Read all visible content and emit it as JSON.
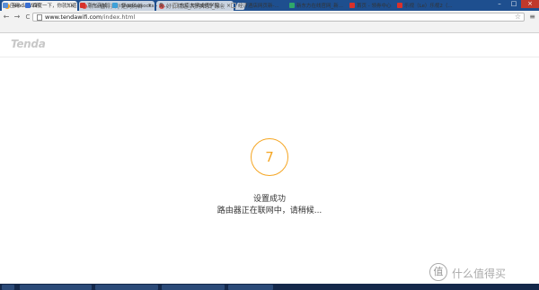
{
  "browser": {
    "tabs": [
      {
        "title": "Tenda WiFi",
        "active": true,
        "favicon_color": "#f5a623"
      },
      {
        "title": "什么值得买 | 是网购首",
        "active": false,
        "favicon_color": "#d9534f"
      },
      {
        "title": "好价精选_网购晒货_原创",
        "active": false,
        "favicon_color": "#d9534f"
      }
    ],
    "close_glyph": "×",
    "window_controls": [
      "–",
      "□",
      "×"
    ],
    "nav": {
      "back": "←",
      "forward": "→",
      "reload": "C"
    },
    "address": {
      "host": "www.tendawifi.com",
      "path": "/index.html"
    },
    "bookmarks": [
      {
        "label": "应用",
        "icon_color": "#5b8fd6"
      },
      {
        "label": "百度一下，你就知道",
        "icon_color": "#3b6fd1"
      },
      {
        "label": "京东商城",
        "icon_color": "#d9312b"
      },
      {
        "label": "iShadowsocks - 免...",
        "icon_color": "#3fa0d8"
      },
      {
        "label": "东南大学成贤学院...",
        "icon_color": "#999999"
      },
      {
        "label": "经济酒店网页新-...",
        "icon_color": "#999999"
      },
      {
        "label": "新东方在线官网_新...",
        "icon_color": "#2fa86a"
      },
      {
        "label": "首页 - 领券中心",
        "icon_color": "#d9312b"
      },
      {
        "label": "乐视（Le）乐视2（...",
        "icon_color": "#d9312b"
      }
    ]
  },
  "page": {
    "logo": "Tenda",
    "countdown": "7",
    "status_title": "设置成功",
    "status_message": "路由器正在联网中，请稍候...",
    "accent_color": "#f5a623"
  },
  "watermark": {
    "icon": "值",
    "text": "什么值得买"
  }
}
